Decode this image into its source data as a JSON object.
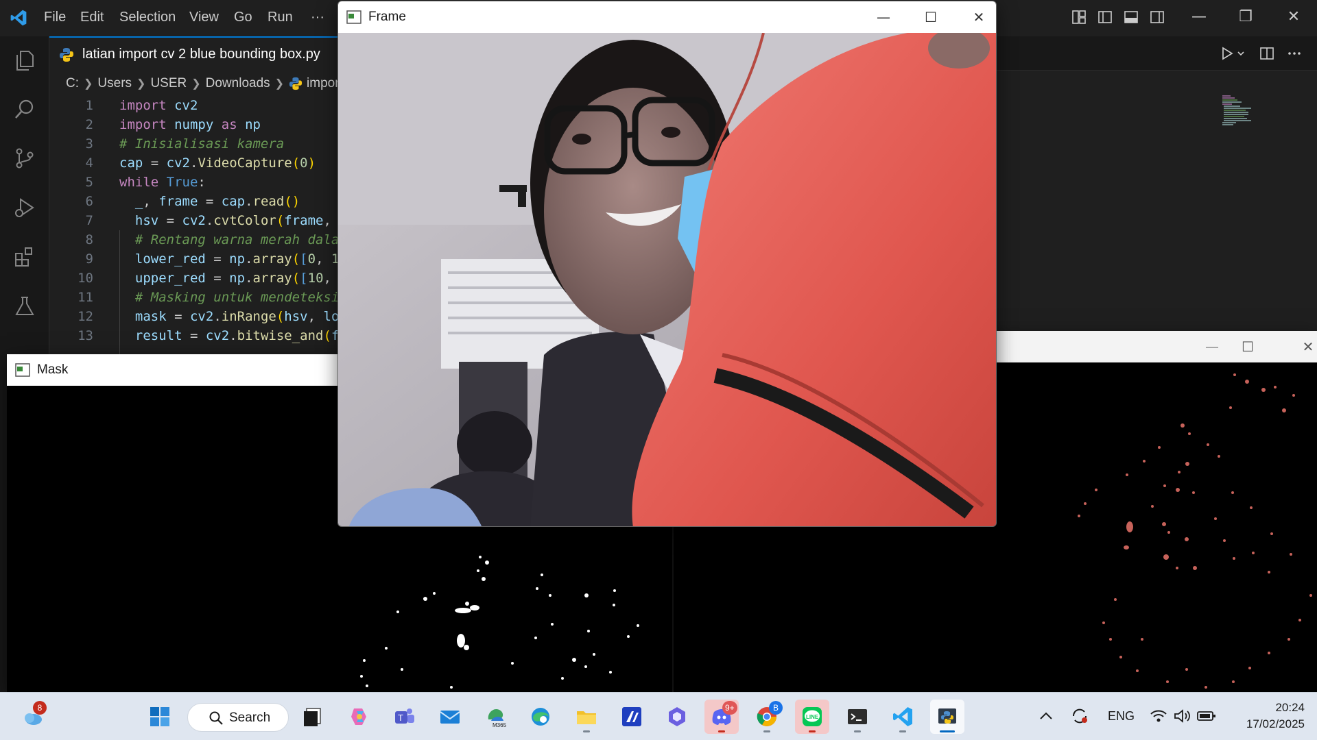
{
  "vscode": {
    "menu": [
      "File",
      "Edit",
      "Selection",
      "View",
      "Go",
      "Run",
      "···"
    ],
    "tab_title": "latian import cv 2 blue bounding box.py",
    "breadcrumb": [
      "C:",
      "Users",
      "USER",
      "Downloads",
      "import"
    ],
    "code_lines": [
      {
        "n": "1"
      },
      {
        "n": "2"
      },
      {
        "n": "3"
      },
      {
        "n": "4"
      },
      {
        "n": "5"
      },
      {
        "n": "6"
      },
      {
        "n": "7"
      },
      {
        "n": "8"
      },
      {
        "n": "9"
      },
      {
        "n": "10"
      },
      {
        "n": "11"
      },
      {
        "n": "12"
      },
      {
        "n": "13"
      }
    ],
    "colors": {
      "accent": "#0078d4",
      "background": "#1f1f1f"
    }
  },
  "windows": {
    "frame_title": "Frame",
    "mask_title": "Mask"
  },
  "taskbar": {
    "search_label": "Search",
    "weather_badge": "8",
    "discord_badge": "9+",
    "chrome_badge": "B",
    "m365_label": "M365",
    "line_label": "LINE",
    "language": "ENG",
    "time": "20:24",
    "date": "17/02/2025",
    "icons": [
      "weather-icon",
      "start-icon",
      "search-icon",
      "task-view-icon",
      "copilot-icon",
      "teams-icon",
      "mail-icon",
      "m365-icon",
      "edge-icon",
      "file-explorer-icon",
      "app-icon",
      "copilot-app-icon",
      "discord-icon",
      "chrome-icon",
      "line-icon",
      "terminal-icon",
      "vscode-icon",
      "python-icon"
    ]
  }
}
